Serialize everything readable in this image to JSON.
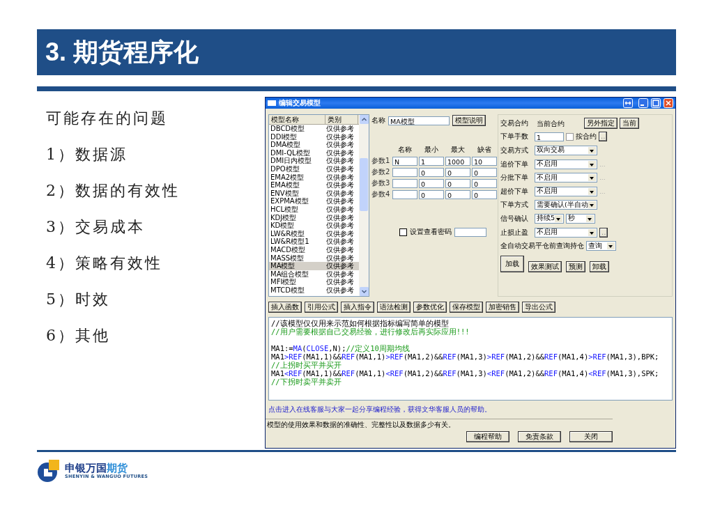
{
  "slide": {
    "title": "3. 期货程序化",
    "points": [
      "可能存在的问题",
      "1）数据源",
      "2）数据的有效性",
      "3）交易成本",
      "4）策略有效性",
      "5）时效",
      "6）其他"
    ],
    "logo": {
      "name_parts": [
        {
          "text": "申银万国",
          "kind": "dark"
        },
        {
          "text": "期货",
          "kind": "light"
        }
      ],
      "tagline": "SHENYIN & WANGUO FUTURES"
    }
  },
  "window": {
    "title": "编辑交易模型",
    "model_list": {
      "columns": [
        "模型名称",
        "类别"
      ],
      "rows": [
        {
          "name": "DBCD模型",
          "category": "仅供参考",
          "selected": false
        },
        {
          "name": "DDI模型",
          "category": "仅供参考",
          "selected": false
        },
        {
          "name": "DMA模型",
          "category": "仅供参考",
          "selected": false
        },
        {
          "name": "DMI-QL模型",
          "category": "仅供参考",
          "selected": false
        },
        {
          "name": "DMI日内模型",
          "category": "仅供参考",
          "selected": false
        },
        {
          "name": "DPO模型",
          "category": "仅供参考",
          "selected": false
        },
        {
          "name": "EMA2模型",
          "category": "仅供参考",
          "selected": false
        },
        {
          "name": "EMA模型",
          "category": "仅供参考",
          "selected": false
        },
        {
          "name": "ENV模型",
          "category": "仅供参考",
          "selected": false
        },
        {
          "name": "EXPMA模型",
          "category": "仅供参考",
          "selected": false
        },
        {
          "name": "HCL模型",
          "category": "仅供参考",
          "selected": false
        },
        {
          "name": "KDJ模型",
          "category": "仅供参考",
          "selected": false
        },
        {
          "name": "KD模型",
          "category": "仅供参考",
          "selected": false
        },
        {
          "name": "LW&R模型",
          "category": "仅供参考",
          "selected": false
        },
        {
          "name": "LW&R模型1",
          "category": "仅供参考",
          "selected": false
        },
        {
          "name": "MACD模型",
          "category": "仅供参考",
          "selected": false
        },
        {
          "name": "MASS模型",
          "category": "仅供参考",
          "selected": false
        },
        {
          "name": "MA模型",
          "category": "仅供参考",
          "selected": true
        },
        {
          "name": "MA组合模型",
          "category": "仅供参考",
          "selected": false
        },
        {
          "name": "MFI模型",
          "category": "仅供参考",
          "selected": false
        },
        {
          "name": "MTCD模型",
          "category": "仅供参考",
          "selected": false
        }
      ]
    },
    "model_name": {
      "label": "名称",
      "value": "MA模型"
    },
    "describe_button": "模型说明",
    "params": {
      "columns": [
        "名称",
        "最小",
        "最大",
        "缺省"
      ],
      "rows": [
        {
          "label": "参数1",
          "name": "N",
          "min": "1",
          "max": "1000",
          "default": "10"
        },
        {
          "label": "参数2",
          "min": "0",
          "max": "0",
          "default": "0"
        },
        {
          "label": "参数3",
          "min": "0",
          "max": "0",
          "default": "0"
        },
        {
          "label": "参数4",
          "min": "0",
          "max": "0",
          "default": "0"
        }
      ]
    },
    "password": {
      "label": "设置查看密码",
      "checked": false
    },
    "settings": [
      {
        "kind": "contract",
        "label": "交易合约",
        "value": "当前合约",
        "buttons": [
          "另外指定",
          "当前"
        ]
      },
      {
        "kind": "input",
        "label": "下单手数",
        "value": "1",
        "checkbox": {
          "label": "按合约",
          "checked": false
        },
        "button": ".."
      },
      {
        "kind": "select",
        "label": "交易方式",
        "value": "双向交易"
      },
      {
        "kind": "select",
        "label": "追价下单",
        "value": "不启用",
        "more": "..."
      },
      {
        "kind": "select",
        "label": "分批下单",
        "value": "不启用",
        "more": "..."
      },
      {
        "kind": "select",
        "label": "超价下单",
        "value": "不启用",
        "more": "..."
      },
      {
        "kind": "select",
        "label": "下单方式",
        "value": "需要确认(半自动"
      },
      {
        "kind": "double_select",
        "label": "信号确认",
        "values": [
          "持续5",
          "秒"
        ]
      },
      {
        "kind": "select",
        "label": "止损止盈",
        "value": "不启用",
        "button": ".."
      },
      {
        "kind": "query",
        "label": "全自动交易平仓前查询持仓",
        "value": "查询"
      }
    ],
    "load_button": "加载",
    "action_buttons": [
      "效果测试",
      "预测",
      "卸载"
    ],
    "toolbar": [
      "插入函数",
      "引用公式",
      "插入指令",
      "语法检测",
      "参数优化",
      "保存模型",
      "加密销售",
      "导出公式"
    ],
    "code_lines": [
      {
        "segments": [
          {
            "kind": "text",
            "text": "//该模型仅仅用来示范如何根据指标编写简单的模型"
          }
        ]
      },
      {
        "segments": [
          {
            "kind": "comment",
            "text": "//用户需要根据自己交易经验，进行修改后再实际应用!!!"
          }
        ]
      },
      {
        "blank_before": true,
        "segments": [
          {
            "kind": "text",
            "text": "MA1:="
          },
          {
            "kind": "kw",
            "text": "MA"
          },
          {
            "kind": "text",
            "text": "("
          },
          {
            "kind": "kw",
            "text": "CLOSE"
          },
          {
            "kind": "text",
            "text": ",N);"
          },
          {
            "kind": "comment",
            "text": "//定义10周期均线"
          }
        ]
      },
      {
        "segments": [
          {
            "kind": "text",
            "text": "MA1"
          },
          {
            "kind": "kw",
            "text": ">REF"
          },
          {
            "kind": "text",
            "text": "(MA1,1)&&"
          },
          {
            "kind": "kw",
            "text": "REF"
          },
          {
            "kind": "text",
            "text": "(MA1,1)"
          },
          {
            "kind": "kw",
            "text": ">REF"
          },
          {
            "kind": "text",
            "text": "(MA1,2)&&"
          },
          {
            "kind": "kw",
            "text": "REF"
          },
          {
            "kind": "text",
            "text": "(MA1,3)"
          },
          {
            "kind": "kw",
            "text": ">REF"
          },
          {
            "kind": "text",
            "text": "(MA1,2)&&"
          },
          {
            "kind": "kw",
            "text": "REF"
          },
          {
            "kind": "text",
            "text": "(MA1,4)"
          },
          {
            "kind": "kw",
            "text": ">REF"
          },
          {
            "kind": "text",
            "text": "(MA1,3),BPK;"
          }
        ]
      },
      {
        "segments": [
          {
            "kind": "comment",
            "text": "//上拐时买平并买开"
          }
        ]
      },
      {
        "segments": [
          {
            "kind": "text",
            "text": "MA1"
          },
          {
            "kind": "kw",
            "text": "<REF"
          },
          {
            "kind": "text",
            "text": "(MA1,1)&&"
          },
          {
            "kind": "kw",
            "text": "REF"
          },
          {
            "kind": "text",
            "text": "(MA1,1)"
          },
          {
            "kind": "kw",
            "text": "<REF"
          },
          {
            "kind": "text",
            "text": "(MA1,2)&&"
          },
          {
            "kind": "kw",
            "text": "REF"
          },
          {
            "kind": "text",
            "text": "(MA1,3)"
          },
          {
            "kind": "kw",
            "text": "<REF"
          },
          {
            "kind": "text",
            "text": "(MA1,2)&&"
          },
          {
            "kind": "kw",
            "text": "REF"
          },
          {
            "kind": "text",
            "text": "(MA1,4)"
          },
          {
            "kind": "kw",
            "text": "<REF"
          },
          {
            "kind": "text",
            "text": "(MA1,3),SPK;"
          }
        ]
      },
      {
        "segments": [
          {
            "kind": "comment",
            "text": "//下拐时卖平并卖开"
          }
        ]
      }
    ],
    "help_link": "点击进入在线客服与大家一起分享编程经验，获得文华客服人员的帮助。",
    "status_text": "模型的使用效果和数据的准确性、完整性以及数据多少有关。",
    "footer_buttons": [
      "编程帮助",
      "免责条款",
      "关闭"
    ]
  }
}
